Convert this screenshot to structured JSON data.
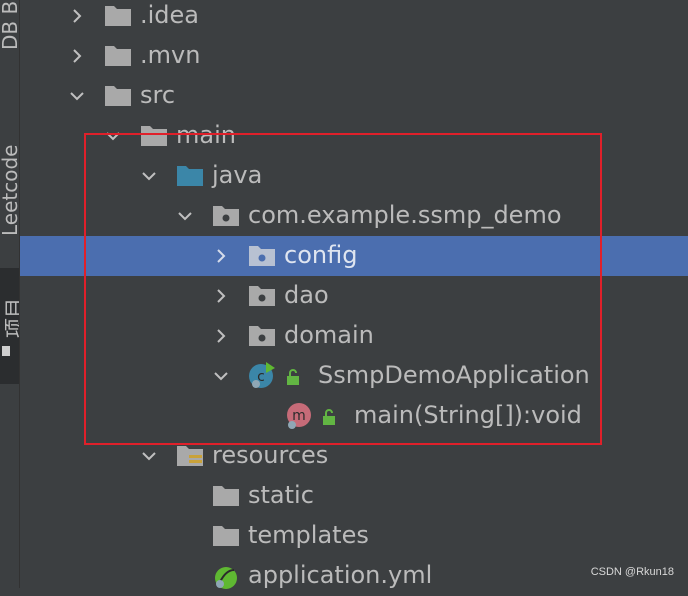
{
  "side_panel": {
    "tab_db": "DB B",
    "tab_leetcode": "Leetcode",
    "tab_project": "项目"
  },
  "tree": {
    "items": [
      {
        "label": ".idea",
        "kind": "folder",
        "expanded": false
      },
      {
        "label": ".mvn",
        "kind": "folder",
        "expanded": false
      },
      {
        "label": "src",
        "kind": "folder",
        "expanded": true
      },
      {
        "label": "main",
        "kind": "folder",
        "expanded": true
      },
      {
        "label": "java",
        "kind": "source-folder",
        "expanded": true
      },
      {
        "label": "com.example.ssmp_demo",
        "kind": "package",
        "expanded": true
      },
      {
        "label": "config",
        "kind": "package",
        "expanded": false,
        "selected": true
      },
      {
        "label": "dao",
        "kind": "package",
        "expanded": false
      },
      {
        "label": "domain",
        "kind": "package",
        "expanded": false
      },
      {
        "label": "SsmpDemoApplication",
        "kind": "spring-boot-class",
        "expanded": true
      },
      {
        "label": "main(String[]):void",
        "kind": "method"
      },
      {
        "label": "resources",
        "kind": "resources-folder",
        "expanded": true
      },
      {
        "label": "static",
        "kind": "folder"
      },
      {
        "label": "templates",
        "kind": "folder"
      },
      {
        "label": "application.yml",
        "kind": "spring-config-file"
      }
    ]
  },
  "watermark": "CSDN @Rkun18",
  "colors": {
    "background": "#3c3f41",
    "selection": "#4b6eaf",
    "text": "#bbbbbb",
    "highlight_border": "#e0202a",
    "source_folder": "#3b86a8"
  }
}
